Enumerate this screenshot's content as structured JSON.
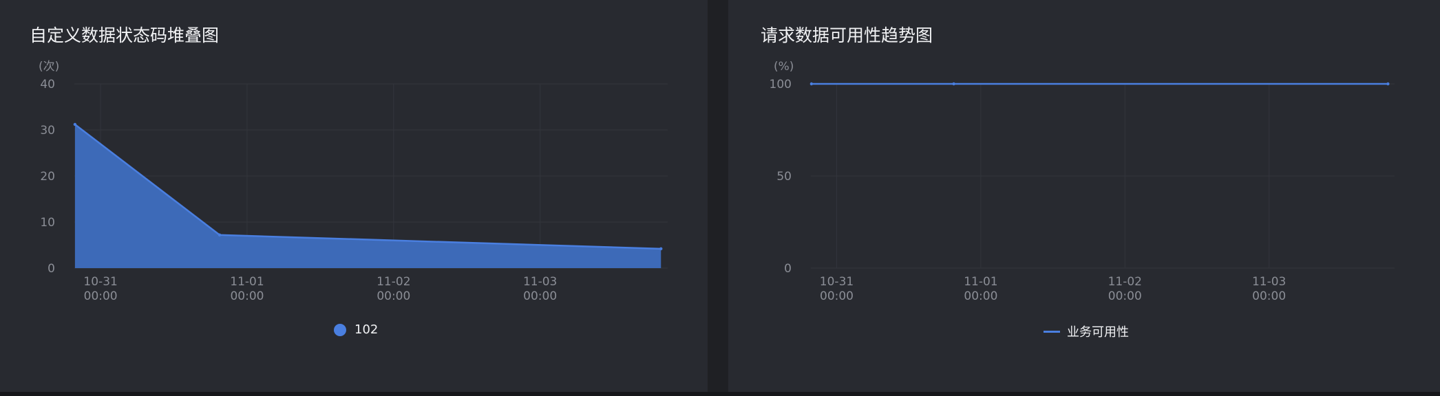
{
  "colors": {
    "series_fill": "#3d6ab8",
    "series_line": "#4a7fe0",
    "grid": "#33353c"
  },
  "panels": [
    {
      "title": "自定义数据状态码堆叠图",
      "unit": "(次)",
      "legend": {
        "label": "102",
        "icon": "circle"
      }
    },
    {
      "title": "请求数据可用性趋势图",
      "unit": "(%)",
      "legend": {
        "label": "业务可用性",
        "icon": "line"
      }
    }
  ],
  "chart_data": [
    {
      "type": "area",
      "title": "自定义数据状态码堆叠图",
      "ylabel": "(次)",
      "ylim": [
        0,
        40
      ],
      "yticks": [
        0,
        10,
        20,
        30,
        40
      ],
      "xticks": [
        {
          "x": 0,
          "line1": "10-31",
          "line2": "00:00"
        },
        {
          "x": 24,
          "line1": "11-01",
          "line2": "00:00"
        },
        {
          "x": 48,
          "line1": "11-02",
          "line2": "00:00"
        },
        {
          "x": 72,
          "line1": "11-03",
          "line2": "00:00"
        }
      ],
      "xlim": [
        -4.3,
        92.9
      ],
      "grid": true,
      "legend_position": "bottom",
      "series": [
        {
          "name": "102",
          "points": [
            {
              "x": -4.2,
              "y": 31.2
            },
            {
              "x": 19.5,
              "y": 7.2
            },
            {
              "x": 91.8,
              "y": 4.2
            }
          ]
        }
      ]
    },
    {
      "type": "line",
      "title": "请求数据可用性趋势图",
      "ylabel": "(%)",
      "ylim": [
        0,
        100
      ],
      "yticks": [
        0,
        50,
        100
      ],
      "xticks": [
        {
          "x": 0,
          "line1": "10-31",
          "line2": "00:00"
        },
        {
          "x": 24,
          "line1": "11-01",
          "line2": "00:00"
        },
        {
          "x": 48,
          "line1": "11-02",
          "line2": "00:00"
        },
        {
          "x": 72,
          "line1": "11-03",
          "line2": "00:00"
        }
      ],
      "xlim": [
        -4.3,
        92.9
      ],
      "grid": true,
      "legend_position": "bottom",
      "series": [
        {
          "name": "业务可用性",
          "points": [
            {
              "x": -4.2,
              "y": 100
            },
            {
              "x": 19.5,
              "y": 100
            },
            {
              "x": 91.8,
              "y": 100
            }
          ]
        }
      ]
    }
  ]
}
